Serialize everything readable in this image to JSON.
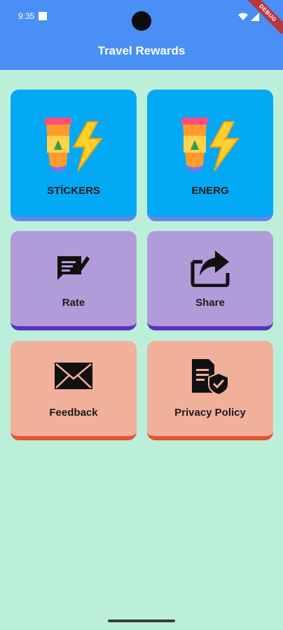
{
  "status": {
    "time": "9:35",
    "debug_label": "DEBUG"
  },
  "appbar": {
    "title": "Travel Rewards"
  },
  "cards": [
    {
      "label": "STİCKERS",
      "icon": "coffee-lightning-icon"
    },
    {
      "label": "ENERG",
      "icon": "coffee-lightning-icon"
    },
    {
      "label": "Rate",
      "icon": "rate-review-icon"
    },
    {
      "label": "Share",
      "icon": "share-icon"
    },
    {
      "label": "Feedback",
      "icon": "envelope-icon"
    },
    {
      "label": "Privacy Policy",
      "icon": "privacy-policy-icon"
    }
  ],
  "colors": {
    "primary": "#4a8ff5",
    "background": "#bcefd9",
    "card_blue": "#03a9f4",
    "card_purple": "#b29bd9",
    "card_salmon": "#f0b09a"
  }
}
